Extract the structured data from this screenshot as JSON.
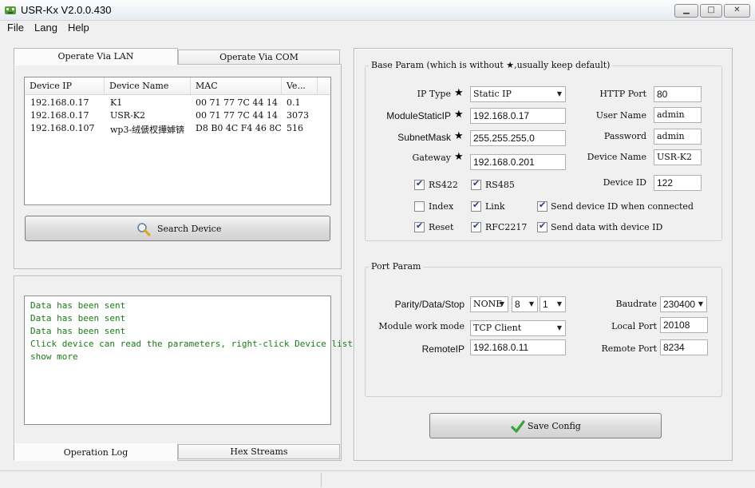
{
  "window": {
    "title": "USR-Kx V2.0.0.430"
  },
  "menu": [
    "File",
    "Lang",
    "Help"
  ],
  "left": {
    "tabs": [
      "Operate Via LAN",
      "Operate Via COM"
    ],
    "device_list": {
      "columns": [
        "Device IP",
        "Device Name",
        "MAC",
        "Ve..."
      ],
      "rows": [
        [
          "192.168.0.17",
          "K1",
          "00 71 77 7C 44 14",
          "0.1"
        ],
        [
          "192.168.0.17",
          "USR-K2",
          "00 71 77 7C 44 14",
          "3073"
        ],
        [
          "192.168.0.107",
          "wp3-绒傂杈撶嫭锛",
          "D8 B0 4C F4 46 8C",
          "516"
        ]
      ]
    },
    "search_button": "Search Device",
    "log_lines": [
      " Data has been sent",
      " Data has been sent",
      " Data has been sent",
      "Click device can read the parameters, right-click Device list",
      "show more"
    ],
    "bottom_tabs": [
      "Operation Log",
      "Hex Streams"
    ]
  },
  "base_param": {
    "legend": "Base Param (which is without ★,usually keep default)",
    "ip_type": {
      "label": "IP Type",
      "value": "Static IP"
    },
    "module_static_ip": {
      "label": "ModuleStaticIP",
      "value": "192.168.0.17"
    },
    "subnet_mask": {
      "label": "SubnetMask",
      "value": "255.255.255.0"
    },
    "gateway": {
      "label": "Gateway",
      "value": "192.168.0.201"
    },
    "http_port": {
      "label": "HTTP Port",
      "value": "80"
    },
    "user_name": {
      "label": "User Name",
      "value": "admin"
    },
    "password": {
      "label": "Password",
      "value": "admin"
    },
    "device_name": {
      "label": "Device Name",
      "value": "USR-K2"
    },
    "device_id": {
      "label": "Device ID",
      "value": "122"
    },
    "checkboxes": [
      {
        "label": "RS422",
        "checked": true
      },
      {
        "label": "RS485",
        "checked": true
      },
      {
        "label": "Index",
        "checked": false
      },
      {
        "label": "Link",
        "checked": true
      },
      {
        "label": "Send device ID when connected",
        "checked": true
      },
      {
        "label": "Reset",
        "checked": true
      },
      {
        "label": "RFC2217",
        "checked": true
      },
      {
        "label": "Send data with device ID",
        "checked": true
      }
    ]
  },
  "port_param": {
    "legend": "Port Param",
    "parity_label": "Parity/Data/Stop",
    "parity": "NONE",
    "data_bits": "8",
    "stop_bits": "1",
    "baudrate": {
      "label": "Baudrate",
      "value": "230400"
    },
    "work_mode": {
      "label": "Module work mode",
      "value": "TCP Client"
    },
    "local_port": {
      "label": "Local Port",
      "value": "20108"
    },
    "remote_ip": {
      "label": "RemoteIP",
      "value": "192.168.0.11"
    },
    "remote_port": {
      "label": "Remote Port",
      "value": "8234"
    }
  },
  "save_button": "Save Config",
  "colors": {
    "log_text": "#1a7a1a",
    "checkmark": "#2b3f7a",
    "save_tick": "#3aa23a",
    "search_icon": "#e0a020"
  }
}
